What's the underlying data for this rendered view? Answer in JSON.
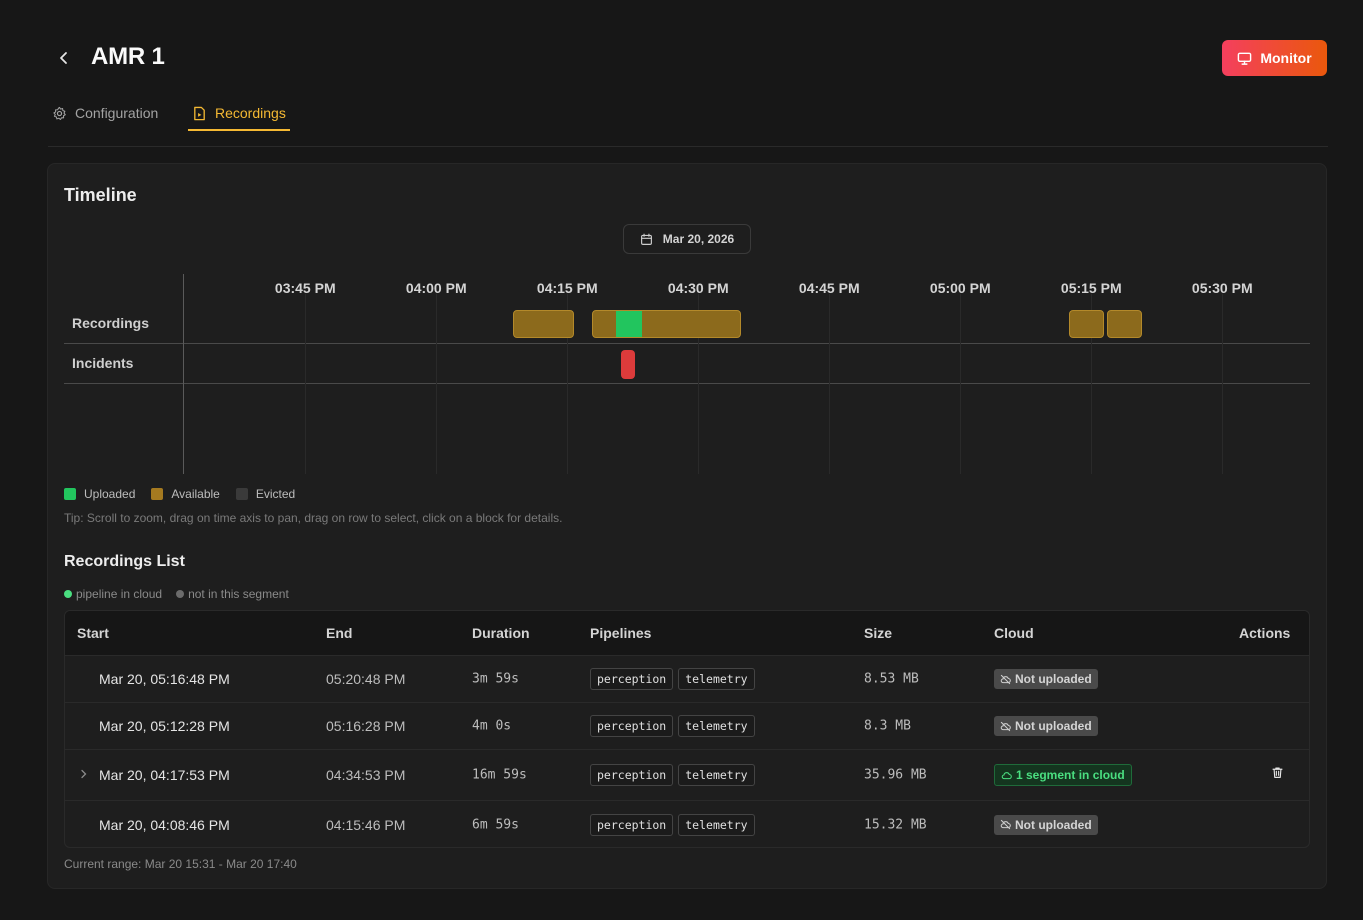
{
  "header": {
    "title": "AMR 1",
    "monitor_label": "Monitor"
  },
  "tabs": [
    {
      "label": "Configuration",
      "icon": "gear-icon",
      "active": false
    },
    {
      "label": "Recordings",
      "icon": "file-video-icon",
      "active": true
    }
  ],
  "timeline": {
    "title": "Timeline",
    "date": "Mar 20, 2026",
    "ticks": [
      "03:45 PM",
      "04:00 PM",
      "04:15 PM",
      "04:30 PM",
      "04:45 PM",
      "05:00 PM",
      "05:15 PM",
      "05:30 PM"
    ],
    "rows": {
      "recordings": "Recordings",
      "incidents": "Incidents"
    },
    "recording_blocks": [
      {
        "start": "04:08:46 PM",
        "end": "04:15:46 PM",
        "status": "available"
      },
      {
        "start": "04:17:53 PM",
        "end": "04:34:53 PM",
        "status": "available",
        "uploaded_segment": {
          "start": "04:20:30 PM",
          "end": "04:23:30 PM"
        }
      },
      {
        "start": "05:12:28 PM",
        "end": "05:16:28 PM",
        "status": "available"
      },
      {
        "start": "05:16:48 PM",
        "end": "05:20:48 PM",
        "status": "available"
      }
    ],
    "incidents": [
      {
        "time": "04:22 PM"
      }
    ],
    "legend": [
      {
        "label": "Uploaded",
        "color": "#22c55e"
      },
      {
        "label": "Available",
        "color": "#a57a20"
      },
      {
        "label": "Evicted",
        "color": "#3a3a3a"
      }
    ],
    "tip": "Tip: Scroll to zoom, drag on time axis to pan, drag on row to select, click on a block for details."
  },
  "recordings_list": {
    "title": "Recordings List",
    "legend": [
      {
        "label": "pipeline in cloud",
        "color": "#4ade80"
      },
      {
        "label": "not in this segment",
        "color": "#6b6b6b"
      }
    ],
    "columns": [
      "Start",
      "End",
      "Duration",
      "Pipelines",
      "Size",
      "Cloud",
      "Actions"
    ],
    "rows": [
      {
        "start": "Mar 20, 05:16:48 PM",
        "end": "05:20:48 PM",
        "duration": "3m 59s",
        "pipelines": [
          "perception",
          "telemetry"
        ],
        "size": "8.53 MB",
        "cloud": "Not uploaded",
        "uploaded": false
      },
      {
        "start": "Mar 20, 05:12:28 PM",
        "end": "05:16:28 PM",
        "duration": "4m 0s",
        "pipelines": [
          "perception",
          "telemetry"
        ],
        "size": "8.3 MB",
        "cloud": "Not uploaded",
        "uploaded": false
      },
      {
        "start": "Mar 20, 04:17:53 PM",
        "end": "04:34:53 PM",
        "duration": "16m 59s",
        "pipelines": [
          "perception",
          "telemetry"
        ],
        "size": "35.96 MB",
        "cloud": "1 segment in cloud",
        "uploaded": true
      },
      {
        "start": "Mar 20, 04:08:46 PM",
        "end": "04:15:46 PM",
        "duration": "6m 59s",
        "pipelines": [
          "perception",
          "telemetry"
        ],
        "size": "15.32 MB",
        "cloud": "Not uploaded",
        "uploaded": false
      }
    ],
    "current_range": "Current range: Mar 20 15:31 - Mar 20 17:40"
  }
}
